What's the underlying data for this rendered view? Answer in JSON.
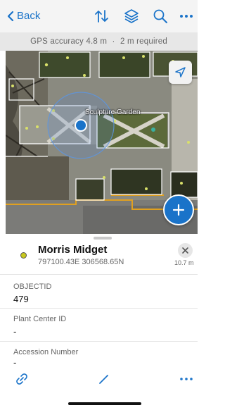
{
  "nav": {
    "back_label": "Back"
  },
  "gps": {
    "accuracy_text": "GPS accuracy 4.8 m",
    "required_text": "2 m required",
    "separator": "·"
  },
  "map": {
    "label": "Sculpture Garden"
  },
  "feature": {
    "title": "Morris Midget",
    "coordinates": "797100.43E 306568.65N",
    "distance": "10.7 m"
  },
  "fields": [
    {
      "label": "OBJECTID",
      "value": "479"
    },
    {
      "label": "Plant Center ID",
      "value": "-"
    },
    {
      "label": "Accession Number",
      "value": "-"
    }
  ],
  "colors": {
    "accent": "#1a73c9",
    "feature_dot": "#c8c81e"
  },
  "icons": [
    "back-chevron-icon",
    "sort-icon",
    "layers-icon",
    "search-icon",
    "more-icon",
    "navigation-arrow-icon",
    "plus-icon",
    "close-icon",
    "link-icon",
    "edit-pencil-icon"
  ]
}
